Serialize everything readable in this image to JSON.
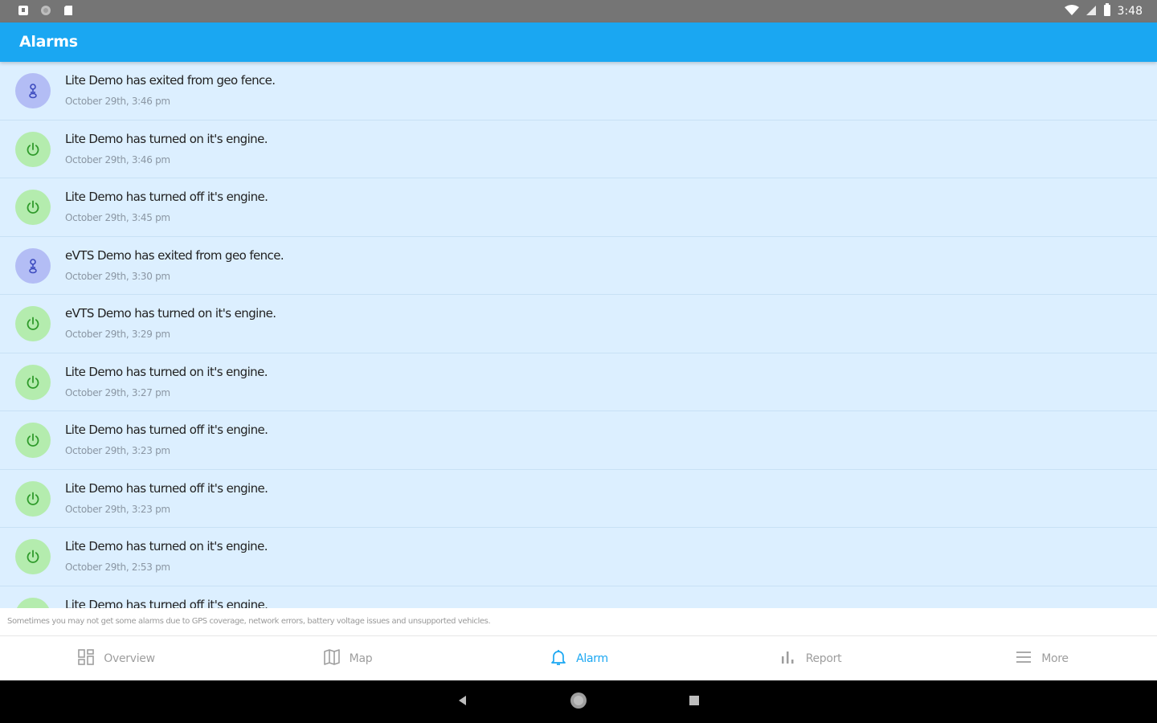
{
  "status_bar": {
    "time": "3:48",
    "left_icons": [
      "notification-icon",
      "circle-icon",
      "sd-card-icon"
    ],
    "right_icons": [
      "wifi-icon",
      "signal-icon",
      "battery-icon"
    ]
  },
  "app_bar": {
    "title": "Alarms"
  },
  "alarms": [
    {
      "type": "geo",
      "icon": "location-person-icon",
      "message": "Lite Demo has exited from geo fence.",
      "time": "October 29th, 3:46 pm"
    },
    {
      "type": "engine",
      "icon": "power-icon",
      "message": "Lite Demo has turned on it's engine.",
      "time": "October 29th, 3:46 pm"
    },
    {
      "type": "engine",
      "icon": "power-icon",
      "message": "Lite Demo has turned off it's engine.",
      "time": "October 29th, 3:45 pm"
    },
    {
      "type": "geo",
      "icon": "location-person-icon",
      "message": "eVTS Demo has exited from geo fence.",
      "time": "October 29th, 3:30 pm"
    },
    {
      "type": "engine",
      "icon": "power-icon",
      "message": "eVTS Demo has turned on it's engine.",
      "time": "October 29th, 3:29 pm"
    },
    {
      "type": "engine",
      "icon": "power-icon",
      "message": "Lite Demo has turned on it's engine.",
      "time": "October 29th, 3:27 pm"
    },
    {
      "type": "engine",
      "icon": "power-icon",
      "message": "Lite Demo has turned off it's engine.",
      "time": "October 29th, 3:23 pm"
    },
    {
      "type": "engine",
      "icon": "power-icon",
      "message": "Lite Demo has turned off it's engine.",
      "time": "October 29th, 3:23 pm"
    },
    {
      "type": "engine",
      "icon": "power-icon",
      "message": "Lite Demo has turned on it's engine.",
      "time": "October 29th, 2:53 pm"
    },
    {
      "type": "engine",
      "icon": "power-icon",
      "message": "Lite Demo has turned off it's engine.",
      "time": ""
    }
  ],
  "notice": "Sometimes you may not get some alarms due to GPS coverage, network errors, battery voltage issues and unsupported vehicles.",
  "bottom_nav": [
    {
      "label": "Overview",
      "icon": "dashboard-icon",
      "active": false
    },
    {
      "label": "Map",
      "icon": "map-icon",
      "active": false
    },
    {
      "label": "Alarm",
      "icon": "bell-icon",
      "active": true
    },
    {
      "label": "Report",
      "icon": "bar-chart-icon",
      "active": false
    },
    {
      "label": "More",
      "icon": "menu-icon",
      "active": false
    }
  ],
  "colors": {
    "primary": "#1aa7f2",
    "list_bg": "#dcefff",
    "geo_avatar": "#b3bdf5",
    "engine_avatar": "#b4ecae",
    "geo_icon": "#3d4bbf",
    "engine_icon": "#2e9a2a"
  },
  "system_nav": [
    "back-icon",
    "home-icon",
    "recents-icon"
  ]
}
